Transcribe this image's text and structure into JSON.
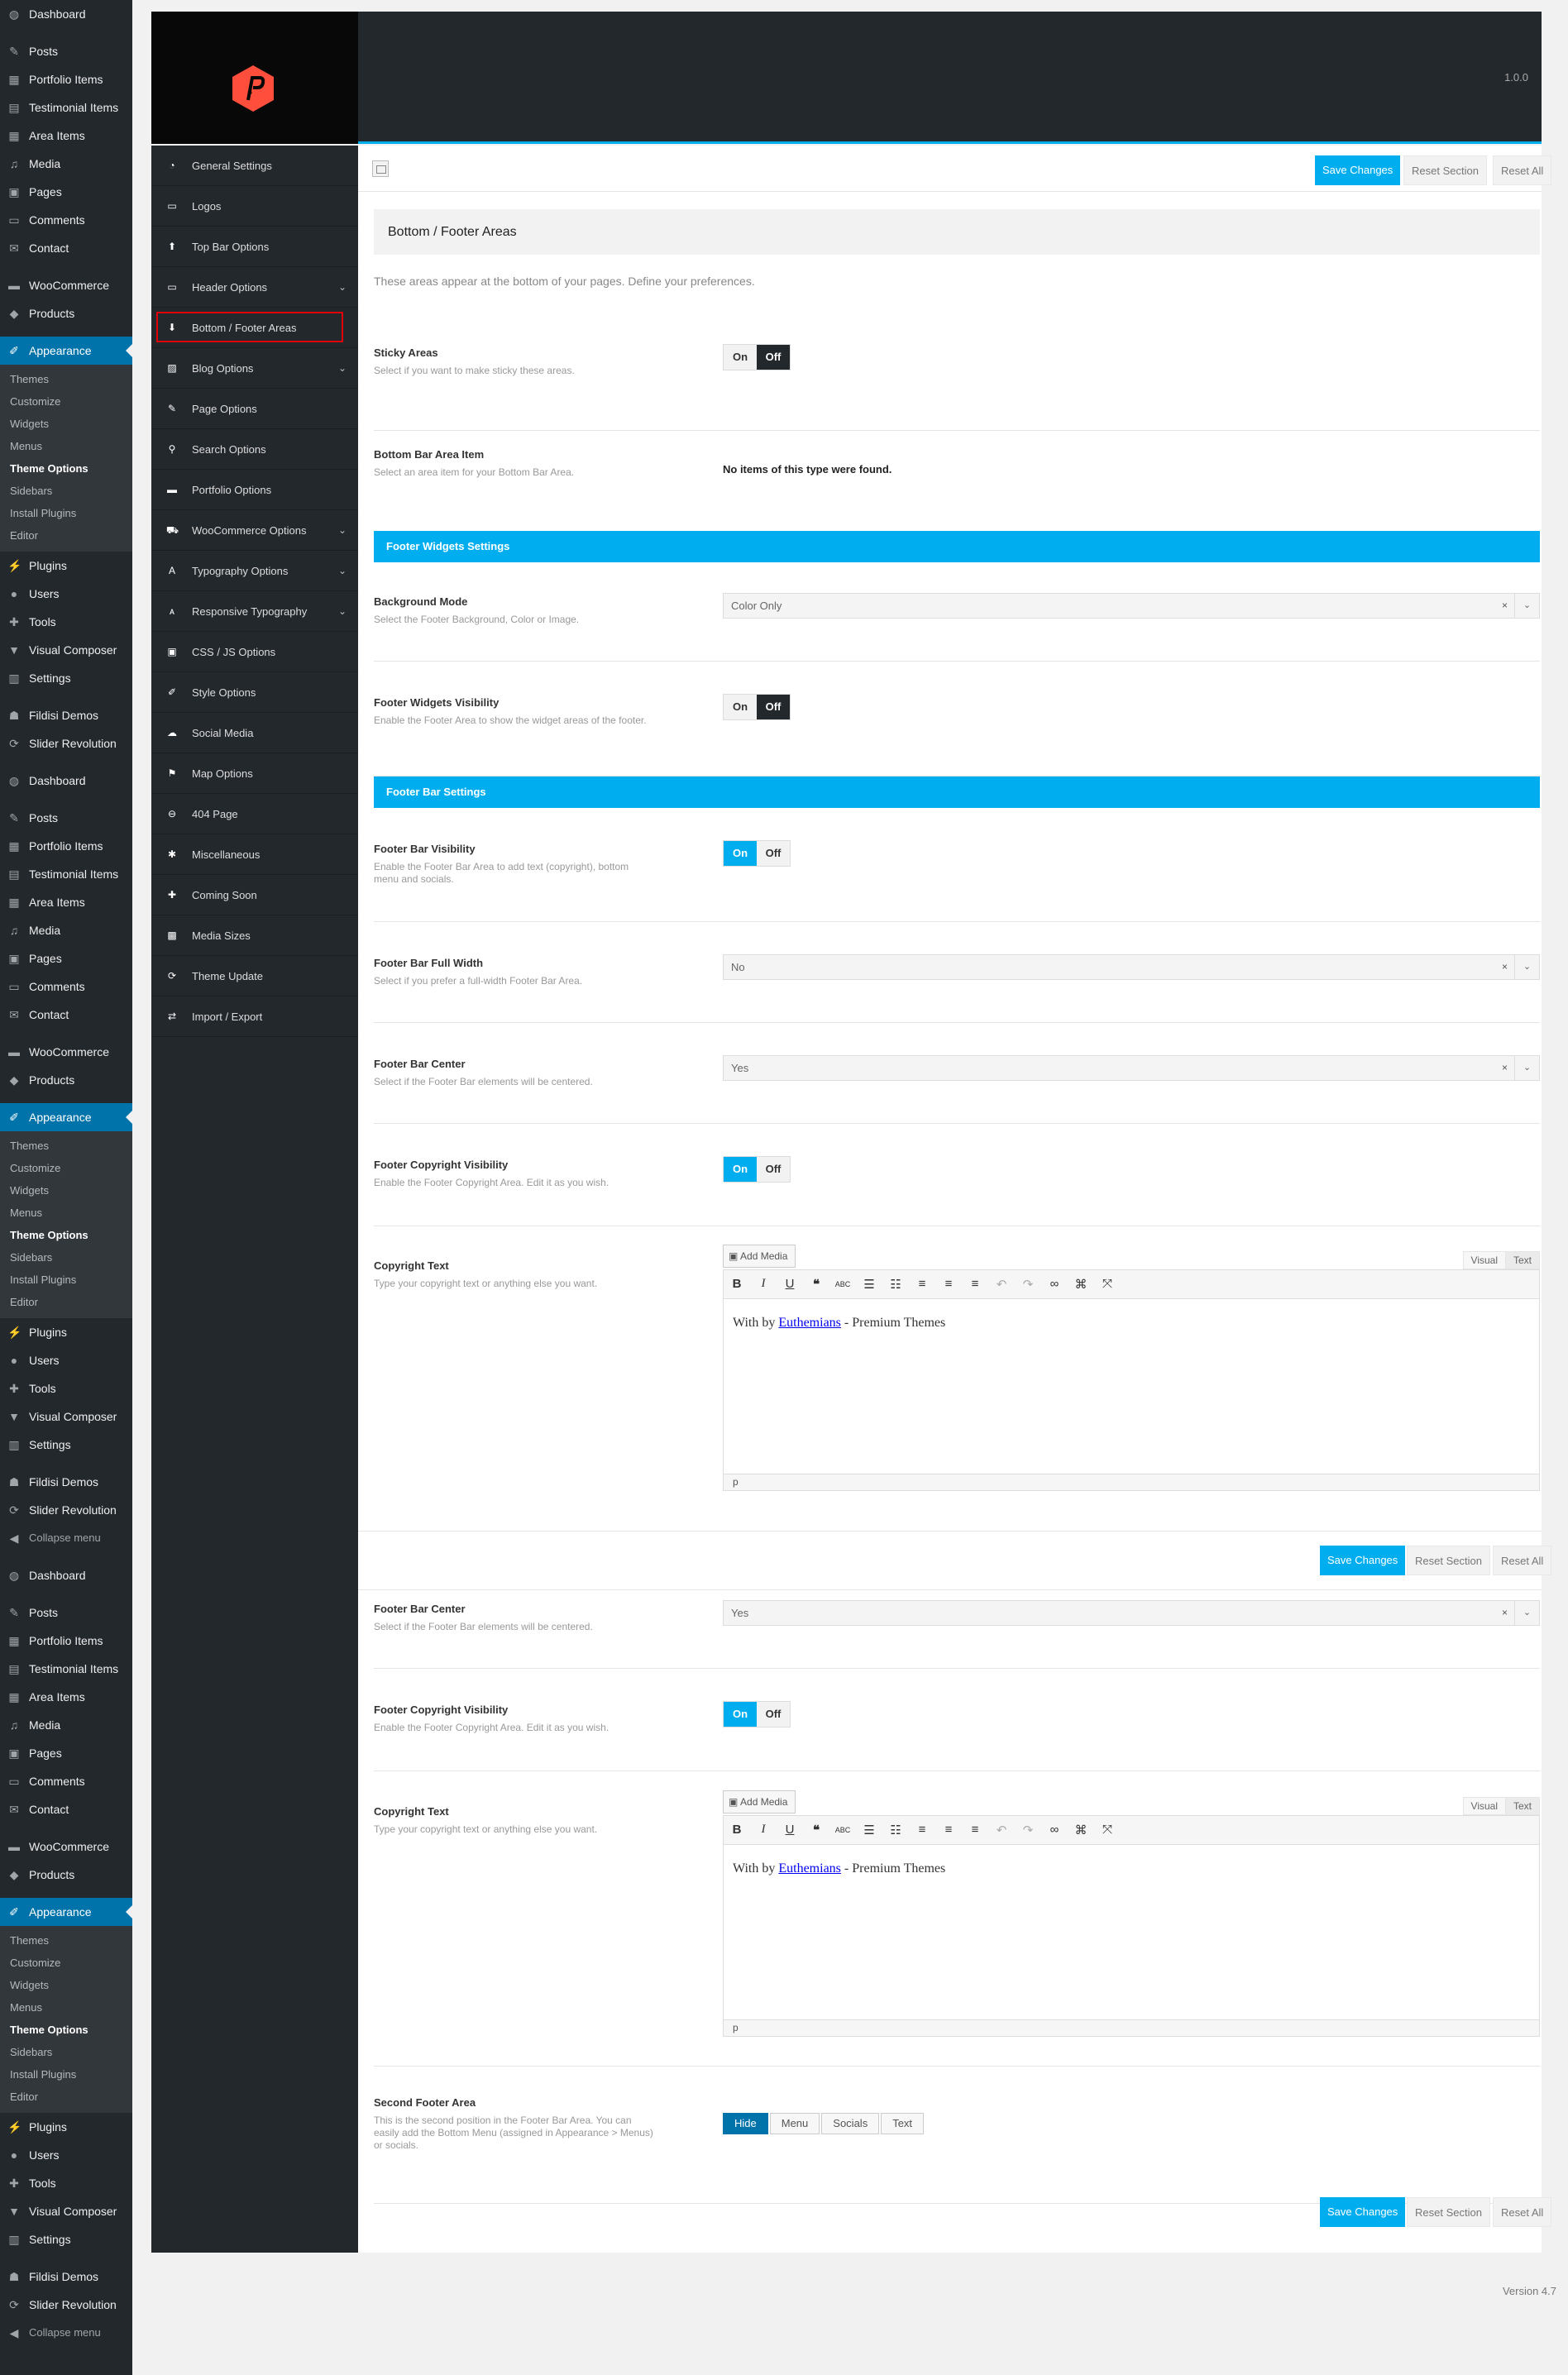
{
  "wp_menu": [
    {
      "type": "item",
      "label": "Dashboard",
      "icon": "dashboard-icon",
      "glyph": "◍"
    },
    {
      "type": "sep"
    },
    {
      "type": "item",
      "label": "Posts",
      "icon": "pin-icon",
      "glyph": "✎"
    },
    {
      "type": "item",
      "label": "Portfolio Items",
      "icon": "portfolio-icon",
      "glyph": "▦"
    },
    {
      "type": "item",
      "label": "Testimonial Items",
      "icon": "testimonial-icon",
      "glyph": "▤"
    },
    {
      "type": "item",
      "label": "Area Items",
      "icon": "area-icon",
      "glyph": "▦"
    },
    {
      "type": "item",
      "label": "Media",
      "icon": "media-icon",
      "glyph": "♫"
    },
    {
      "type": "item",
      "label": "Pages",
      "icon": "pages-icon",
      "glyph": "▣"
    },
    {
      "type": "item",
      "label": "Comments",
      "icon": "comments-icon",
      "glyph": "▭"
    },
    {
      "type": "item",
      "label": "Contact",
      "icon": "mail-icon",
      "glyph": "✉"
    },
    {
      "type": "sep"
    },
    {
      "type": "item",
      "label": "WooCommerce",
      "icon": "woocommerce-icon",
      "glyph": "▬"
    },
    {
      "type": "item",
      "label": "Products",
      "icon": "products-icon",
      "glyph": "◆"
    },
    {
      "type": "sep"
    },
    {
      "type": "item",
      "label": "Appearance",
      "icon": "brush-icon",
      "glyph": "✐",
      "active": true
    },
    {
      "type": "sub",
      "items": [
        "Themes",
        "Customize",
        "Widgets",
        "Menus",
        "Theme Options",
        "Sidebars",
        "Install Plugins",
        "Editor"
      ],
      "current": "Theme Options"
    },
    {
      "type": "item",
      "label": "Plugins",
      "icon": "plug-icon",
      "glyph": "⚡"
    },
    {
      "type": "item",
      "label": "Users",
      "icon": "user-icon",
      "glyph": "●"
    },
    {
      "type": "item",
      "label": "Tools",
      "icon": "wrench-icon",
      "glyph": "✚"
    },
    {
      "type": "item",
      "label": "Visual Composer",
      "icon": "visual-composer-icon",
      "glyph": "▼"
    },
    {
      "type": "item",
      "label": "Settings",
      "icon": "settings-icon",
      "glyph": "▥"
    },
    {
      "type": "sep"
    },
    {
      "type": "item",
      "label": "Fildisi Demos",
      "icon": "demos-icon",
      "glyph": "☗"
    },
    {
      "type": "item",
      "label": "Slider Revolution",
      "icon": "refresh-icon",
      "glyph": "⟳"
    },
    {
      "type": "sep"
    },
    {
      "type": "item",
      "label": "Dashboard",
      "icon": "dashboard-icon",
      "glyph": "◍"
    },
    {
      "type": "sep"
    },
    {
      "type": "item",
      "label": "Posts",
      "icon": "pin-icon",
      "glyph": "✎"
    },
    {
      "type": "item",
      "label": "Portfolio Items",
      "icon": "portfolio-icon",
      "glyph": "▦"
    },
    {
      "type": "item",
      "label": "Testimonial Items",
      "icon": "testimonial-icon",
      "glyph": "▤"
    },
    {
      "type": "item",
      "label": "Area Items",
      "icon": "area-icon",
      "glyph": "▦"
    },
    {
      "type": "item",
      "label": "Media",
      "icon": "media-icon",
      "glyph": "♫"
    },
    {
      "type": "item",
      "label": "Pages",
      "icon": "pages-icon",
      "glyph": "▣"
    },
    {
      "type": "item",
      "label": "Comments",
      "icon": "comments-icon",
      "glyph": "▭"
    },
    {
      "type": "item",
      "label": "Contact",
      "icon": "mail-icon",
      "glyph": "✉"
    },
    {
      "type": "sep"
    },
    {
      "type": "item",
      "label": "WooCommerce",
      "icon": "woocommerce-icon",
      "glyph": "▬"
    },
    {
      "type": "item",
      "label": "Products",
      "icon": "products-icon",
      "glyph": "◆"
    },
    {
      "type": "sep"
    },
    {
      "type": "item",
      "label": "Appearance",
      "icon": "brush-icon",
      "glyph": "✐",
      "active": true
    },
    {
      "type": "sub",
      "items": [
        "Themes",
        "Customize",
        "Widgets",
        "Menus",
        "Theme Options",
        "Sidebars",
        "Install Plugins",
        "Editor"
      ],
      "current": "Theme Options"
    },
    {
      "type": "item",
      "label": "Plugins",
      "icon": "plug-icon",
      "glyph": "⚡"
    },
    {
      "type": "item",
      "label": "Users",
      "icon": "user-icon",
      "glyph": "●"
    },
    {
      "type": "item",
      "label": "Tools",
      "icon": "wrench-icon",
      "glyph": "✚"
    },
    {
      "type": "item",
      "label": "Visual Composer",
      "icon": "visual-composer-icon",
      "glyph": "▼"
    },
    {
      "type": "item",
      "label": "Settings",
      "icon": "settings-icon",
      "glyph": "▥"
    },
    {
      "type": "sep"
    },
    {
      "type": "item",
      "label": "Fildisi Demos",
      "icon": "demos-icon",
      "glyph": "☗"
    },
    {
      "type": "item",
      "label": "Slider Revolution",
      "icon": "refresh-icon",
      "glyph": "⟳"
    },
    {
      "type": "collapse",
      "label": "Collapse menu",
      "icon": "collapse-icon",
      "glyph": "◀"
    },
    {
      "type": "sep"
    },
    {
      "type": "item",
      "label": "Dashboard",
      "icon": "dashboard-icon",
      "glyph": "◍"
    },
    {
      "type": "sep"
    },
    {
      "type": "item",
      "label": "Posts",
      "icon": "pin-icon",
      "glyph": "✎"
    },
    {
      "type": "item",
      "label": "Portfolio Items",
      "icon": "portfolio-icon",
      "glyph": "▦"
    },
    {
      "type": "item",
      "label": "Testimonial Items",
      "icon": "testimonial-icon",
      "glyph": "▤"
    },
    {
      "type": "item",
      "label": "Area Items",
      "icon": "area-icon",
      "glyph": "▦"
    },
    {
      "type": "item",
      "label": "Media",
      "icon": "media-icon",
      "glyph": "♫"
    },
    {
      "type": "item",
      "label": "Pages",
      "icon": "pages-icon",
      "glyph": "▣"
    },
    {
      "type": "item",
      "label": "Comments",
      "icon": "comments-icon",
      "glyph": "▭"
    },
    {
      "type": "item",
      "label": "Contact",
      "icon": "mail-icon",
      "glyph": "✉"
    },
    {
      "type": "sep"
    },
    {
      "type": "item",
      "label": "WooCommerce",
      "icon": "woocommerce-icon",
      "glyph": "▬"
    },
    {
      "type": "item",
      "label": "Products",
      "icon": "products-icon",
      "glyph": "◆"
    },
    {
      "type": "sep"
    },
    {
      "type": "item",
      "label": "Appearance",
      "icon": "brush-icon",
      "glyph": "✐",
      "active": true
    },
    {
      "type": "sub",
      "items": [
        "Themes",
        "Customize",
        "Widgets",
        "Menus",
        "Theme Options",
        "Sidebars",
        "Install Plugins",
        "Editor"
      ],
      "current": "Theme Options"
    },
    {
      "type": "item",
      "label": "Plugins",
      "icon": "plug-icon",
      "glyph": "⚡"
    },
    {
      "type": "item",
      "label": "Users",
      "icon": "user-icon",
      "glyph": "●"
    },
    {
      "type": "item",
      "label": "Tools",
      "icon": "wrench-icon",
      "glyph": "✚"
    },
    {
      "type": "item",
      "label": "Visual Composer",
      "icon": "visual-composer-icon",
      "glyph": "▼"
    },
    {
      "type": "item",
      "label": "Settings",
      "icon": "settings-icon",
      "glyph": "▥"
    },
    {
      "type": "sep"
    },
    {
      "type": "item",
      "label": "Fildisi Demos",
      "icon": "demos-icon",
      "glyph": "☗"
    },
    {
      "type": "item",
      "label": "Slider Revolution",
      "icon": "refresh-icon",
      "glyph": "⟳"
    },
    {
      "type": "collapse",
      "label": "Collapse menu",
      "icon": "collapse-icon",
      "glyph": "◀"
    }
  ],
  "panel": {
    "version": "1.0.0",
    "brand_color": "#ff4e3c",
    "accent_color": "#00aeef"
  },
  "options_menu": [
    {
      "label": "General Settings",
      "icon": "gauge-icon",
      "glyph": "◔"
    },
    {
      "label": "Logos",
      "icon": "monitor-icon",
      "glyph": "▭"
    },
    {
      "label": "Top Bar Options",
      "icon": "arrow-up-icon",
      "glyph": "⬆"
    },
    {
      "label": "Header Options",
      "icon": "monitor-icon",
      "glyph": "▭",
      "chevron": true
    },
    {
      "label": "Bottom / Footer Areas",
      "icon": "arrow-down-icon",
      "glyph": "⬇",
      "active": true
    },
    {
      "label": "Blog Options",
      "icon": "edit-icon",
      "glyph": "▨",
      "chevron": true
    },
    {
      "label": "Page Options",
      "icon": "pencil-icon",
      "glyph": "✎"
    },
    {
      "label": "Search Options",
      "icon": "search-icon",
      "glyph": "⚲"
    },
    {
      "label": "Portfolio Options",
      "icon": "briefcase-icon",
      "glyph": "▬"
    },
    {
      "label": "WooCommerce Options",
      "icon": "cart-icon",
      "glyph": "⛟",
      "chevron": true
    },
    {
      "label": "Typography Options",
      "icon": "typography-icon",
      "glyph": "A",
      "chevron": true
    },
    {
      "label": "Responsive Typography",
      "icon": "text-size-icon",
      "glyph": "ᴀ",
      "chevron": true
    },
    {
      "label": "CSS / JS Options",
      "icon": "code-icon",
      "glyph": "▣"
    },
    {
      "label": "Style Options",
      "icon": "brush-icon",
      "glyph": "✐"
    },
    {
      "label": "Social Media",
      "icon": "cloud-icon",
      "glyph": "☁"
    },
    {
      "label": "Map Options",
      "icon": "map-pin-icon",
      "glyph": "⚑"
    },
    {
      "label": "404 Page",
      "icon": "minus-circle-icon",
      "glyph": "⊖"
    },
    {
      "label": "Miscellaneous",
      "icon": "gear-icon",
      "glyph": "✱"
    },
    {
      "label": "Coming Soon",
      "icon": "wrench-icon",
      "glyph": "✚"
    },
    {
      "label": "Media Sizes",
      "icon": "image-icon",
      "glyph": "▩"
    },
    {
      "label": "Theme Update",
      "icon": "refresh-icon",
      "glyph": "⟳"
    },
    {
      "label": "Import / Export",
      "icon": "sync-icon",
      "glyph": "⇄"
    }
  ],
  "buttons": {
    "save": "Save Changes",
    "reset_section": "Reset Section",
    "reset_all": "Reset All"
  },
  "section": {
    "title": "Bottom / Footer Areas",
    "description": "These areas appear at the bottom of your pages. Define your preferences."
  },
  "toggle_labels": {
    "on": "On",
    "off": "Off"
  },
  "fields": {
    "sticky_areas": {
      "label": "Sticky Areas",
      "sub": "Select if you want to make sticky these areas."
    },
    "bottom_bar_area_item": {
      "label": "Bottom Bar Area Item",
      "sub": "Select an area item for your Bottom Bar Area.",
      "value": "No items of this type were found."
    },
    "footer_widgets_banner": "Footer Widgets Settings",
    "background_mode": {
      "label": "Background Mode",
      "sub": "Select the Footer Background, Color or Image.",
      "value": "Color Only"
    },
    "footer_widgets_visibility": {
      "label": "Footer Widgets Visibility",
      "sub": "Enable the Footer Area to show the widget areas of the footer."
    },
    "footer_bar_banner": "Footer Bar Settings",
    "footer_bar_visibility": {
      "label": "Footer Bar Visibility",
      "sub": "Enable the Footer Bar Area to add text (copyright), bottom menu and socials."
    },
    "footer_bar_full_width": {
      "label": "Footer Bar Full Width",
      "sub": "Select if you prefer a full-width Footer Bar Area.",
      "value": "No"
    },
    "footer_bar_center": {
      "label": "Footer Bar Center",
      "sub": "Select if the Footer Bar elements will be centered.",
      "value": "Yes"
    },
    "footer_copyright_visibility": {
      "label": "Footer Copyright Visibility",
      "sub": "Enable the Footer Copyright Area. Edit it as you wish."
    },
    "copyright_text": {
      "label": "Copyright Text",
      "sub": "Type your copyright text or anything else you want."
    },
    "second_footer_area": {
      "label": "Second Footer Area",
      "sub": "This is the second position in the Footer Bar Area. You can easily add the Bottom Menu (assigned in Appearance > Menus) or socials.",
      "options": [
        "Hide",
        "Menu",
        "Socials",
        "Text"
      ],
      "selected": "Hide"
    }
  },
  "editor": {
    "add_media": "Add Media",
    "tab_visual": "Visual",
    "tab_text": "Text",
    "content_before": "With by ",
    "content_link": "Euthemians",
    "content_after": " - Premium Themes",
    "path": "p"
  },
  "footer_version": "Version 4.7"
}
